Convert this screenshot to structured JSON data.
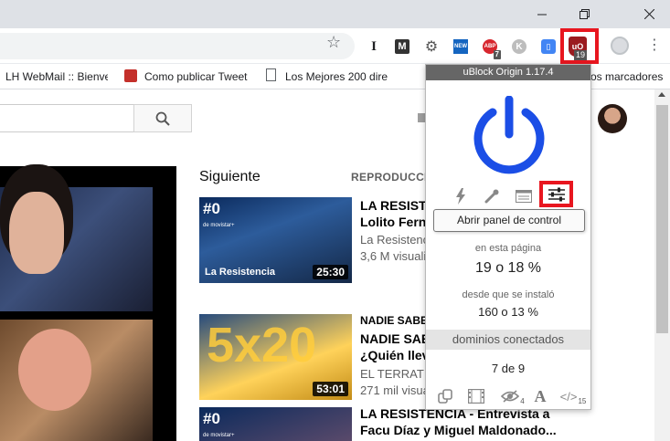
{
  "toolbar": {
    "extensions": [
      {
        "name": "text-extension-icon",
        "glyph": "I"
      },
      {
        "name": "m-extension-icon",
        "glyph": "M"
      },
      {
        "name": "gear-extension-icon",
        "glyph": "⚙"
      },
      {
        "name": "news-extension-icon",
        "glyph": "NEW"
      },
      {
        "name": "abp-extension-icon",
        "glyph": "ABP",
        "badge": "7"
      },
      {
        "name": "k-extension-icon",
        "glyph": "K"
      },
      {
        "name": "translate-extension-icon",
        "glyph": "▯"
      }
    ],
    "ublock_icon": "uO",
    "ublock_count": "19"
  },
  "bookmarks": [
    "LH WebMail :: Bienve",
    "Como publicar Tweet",
    "Los Mejores 200 dire",
    "os marcadores"
  ],
  "colors": {
    "ublock_accent": "#1b4ee6",
    "highlight": "#e8161f",
    "ublock_header": "#666666"
  },
  "youtube": {
    "next_label": "Siguiente",
    "autoplay_label": "REPRODUCCI",
    "videos": [
      {
        "title_lines": [
          "LA RESISTE",
          "Lolito Ferná"
        ],
        "meta_lines": [
          "La Resistenc",
          "3,6 M visuali"
        ],
        "duration": "25:30",
        "thumb_logo": "#0",
        "thumb_logo_small": "de movistar+",
        "thumb_tag": "La Resistencia"
      },
      {
        "title_lines": [
          "NADIE SABE",
          "NADIE SABE",
          "¿Quién lleva"
        ],
        "meta_lines": [
          "EL TERRAT",
          "271 mil visua"
        ],
        "duration": "53:01",
        "thumb_big": "5x20"
      },
      {
        "title_lines": [
          "LA RESISTENCIA - Entrevista a",
          "Facu Díaz y Miguel Maldonado..."
        ],
        "thumb_logo": "#0",
        "thumb_logo_small": "de movistar+"
      }
    ]
  },
  "ublock": {
    "title": "uBlock Origin 1.17.4",
    "tooltip": "Abrir panel de control",
    "this_page_label": "en esta página",
    "this_page_value": "19 o 18 %",
    "since_install_label": "desde que se instaló",
    "since_install_value": "160 o 13 %",
    "domains_label": "dominios conectados",
    "domains_value": "7 de 9",
    "bottom_tools": [
      {
        "name": "popup-toggle-icon",
        "sub": ""
      },
      {
        "name": "media-filmstrip-icon",
        "sub": ""
      },
      {
        "name": "cosmetic-eye-icon",
        "sub": "4"
      },
      {
        "name": "font-icon",
        "glyph": "A",
        "sub": ""
      },
      {
        "name": "script-code-icon",
        "glyph": "</>",
        "sub": "15"
      }
    ]
  }
}
